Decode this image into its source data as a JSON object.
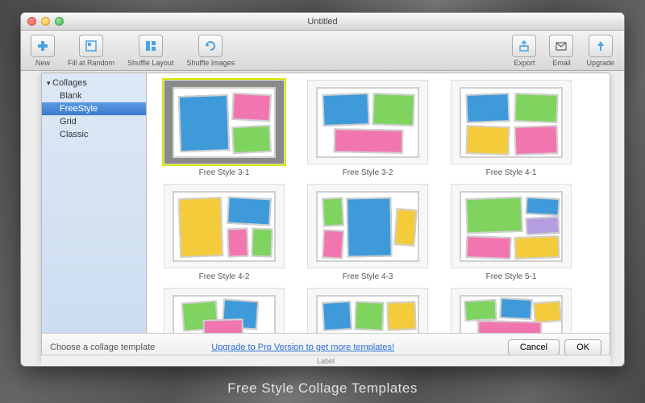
{
  "window": {
    "title": "Untitled"
  },
  "toolbar": {
    "new": "New",
    "fill": "Fill at Random",
    "shuffleLayout": "Shuffle Layout",
    "shuffleImages": "Shuffle Images",
    "export": "Export",
    "email": "Email",
    "upgrade": "Upgrade"
  },
  "sidebar": {
    "root": "Collages",
    "items": [
      "Blank",
      "FreeStyle",
      "Grid",
      "Classic"
    ],
    "selectedIndex": 1
  },
  "templates": [
    {
      "id": "fs31",
      "label": "Free Style 3-1",
      "selected": true
    },
    {
      "id": "fs32",
      "label": "Free Style 3-2",
      "selected": false
    },
    {
      "id": "fs41",
      "label": "Free Style 4-1",
      "selected": false
    },
    {
      "id": "fs42",
      "label": "Free Style 4-2",
      "selected": false
    },
    {
      "id": "fs43",
      "label": "Free Style 4-3",
      "selected": false
    },
    {
      "id": "fs51",
      "label": "Free Style 5-1",
      "selected": false
    },
    {
      "id": "fs52",
      "label": "",
      "selected": false
    },
    {
      "id": "fs53",
      "label": "",
      "selected": false
    },
    {
      "id": "fs61",
      "label": "",
      "selected": false
    }
  ],
  "footer": {
    "msg": "Choose a collage template",
    "link": "Upgrade to Pro Version to get more templates!",
    "cancel": "Cancel",
    "ok": "OK"
  },
  "bottomStrip": "Label",
  "caption": "Free Style Collage Templates",
  "colors": {
    "blue": "#3f9ad9",
    "pink": "#f176b0",
    "yellow": "#f4cb3a",
    "green": "#7fd35f",
    "purple": "#b49ee0"
  }
}
